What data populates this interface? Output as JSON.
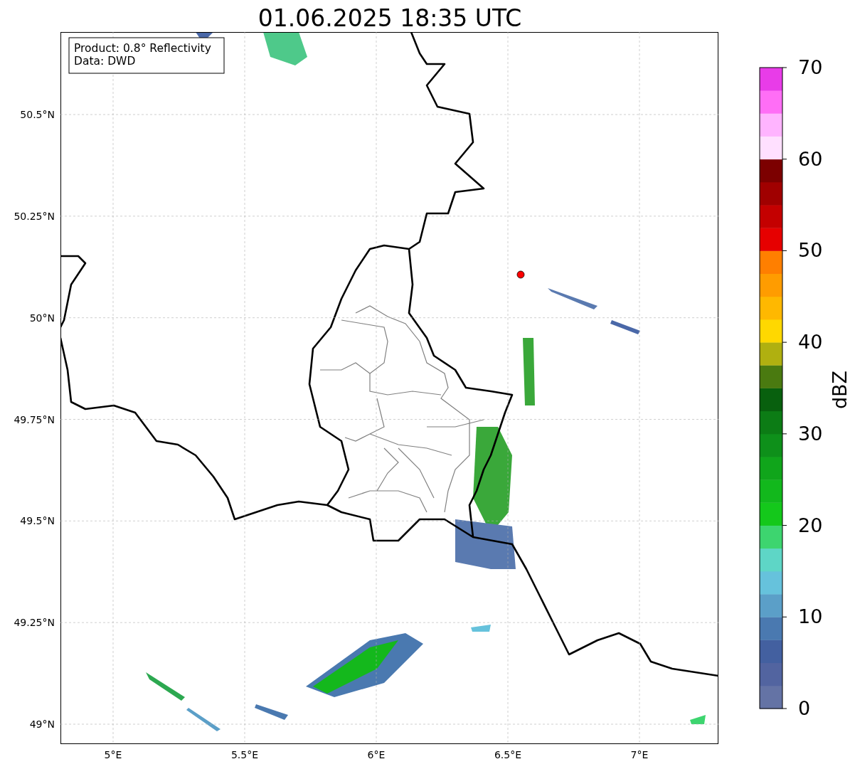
{
  "title": "01.06.2025 18:35 UTC",
  "legend": [
    "Product: 0.8° Reflectivity",
    "Data: DWD"
  ],
  "x_ticks": [
    "5°E",
    "5.5°E",
    "6°E",
    "6.5°E",
    "7°E"
  ],
  "y_ticks": [
    "50.5°N",
    "50.25°N",
    "50°N",
    "49.75°N",
    "49.5°N",
    "49.25°N",
    "49°N"
  ],
  "colorbar": {
    "label": "dBZ",
    "ticks": [
      "70",
      "60",
      "50",
      "40",
      "30",
      "20",
      "10",
      "0"
    ],
    "bands": [
      {
        "color": "#6473a5"
      },
      {
        "color": "#5264a0"
      },
      {
        "color": "#4360a0"
      },
      {
        "color": "#4a79b0"
      },
      {
        "color": "#5b9fc8"
      },
      {
        "color": "#66c2dc"
      },
      {
        "color": "#5ed6c6"
      },
      {
        "color": "#3dd56f"
      },
      {
        "color": "#14c81b"
      },
      {
        "color": "#12b81c"
      },
      {
        "color": "#10a51b"
      },
      {
        "color": "#0e901a"
      },
      {
        "color": "#0c7c15"
      },
      {
        "color": "#08600e"
      },
      {
        "color": "#4a7a10"
      },
      {
        "color": "#b0b010"
      },
      {
        "color": "#ffd800"
      },
      {
        "color": "#ffb800"
      },
      {
        "color": "#ff9c00"
      },
      {
        "color": "#ff7f00"
      },
      {
        "color": "#e60000"
      },
      {
        "color": "#c40000"
      },
      {
        "color": "#a00000"
      },
      {
        "color": "#7c0000"
      },
      {
        "color": "#ffe0ff"
      },
      {
        "color": "#ffb4ff"
      },
      {
        "color": "#ff6ef6"
      },
      {
        "color": "#e83ce8"
      }
    ]
  }
}
